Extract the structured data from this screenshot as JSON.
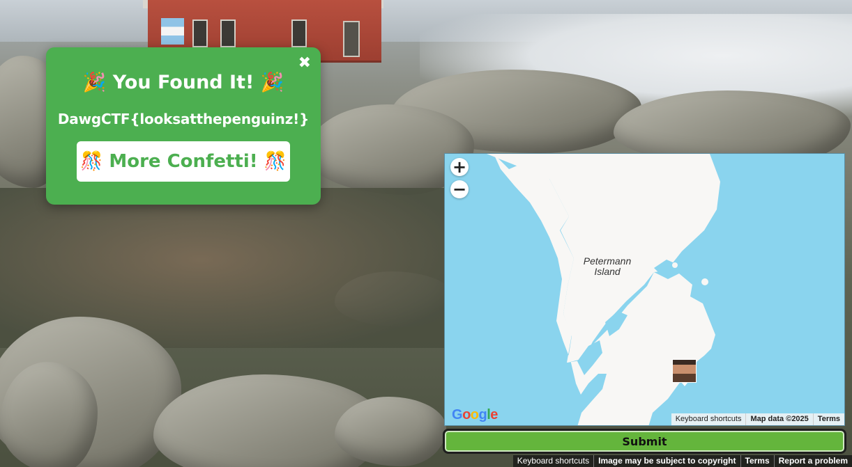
{
  "popup": {
    "title": "🎉 You Found It! 🎉",
    "flag": "DawgCTF{looksatthepenguinz!}",
    "confetti_button": "🎊 More Confetti! 🎊",
    "close_icon": "✖"
  },
  "map": {
    "zoom_in": "+",
    "zoom_out": "−",
    "island_label_line1": "Petermann",
    "island_label_line2": "Island",
    "google_logo": [
      "G",
      "o",
      "o",
      "g",
      "l",
      "e"
    ],
    "google_colors": [
      "#4285F4",
      "#EA4335",
      "#FBBC05",
      "#4285F4",
      "#34A853",
      "#EA4335"
    ],
    "attribution": {
      "keyboard": "Keyboard shortcuts",
      "data": "Map data ©2025",
      "terms": "Terms"
    },
    "water_color": "#8ad4ee",
    "land_color": "#f8f7f5"
  },
  "submit": {
    "label": "Submit"
  },
  "footer": {
    "keyboard": "Keyboard shortcuts",
    "copyright": "Image may be subject to copyright",
    "terms": "Terms",
    "report": "Report a problem"
  }
}
